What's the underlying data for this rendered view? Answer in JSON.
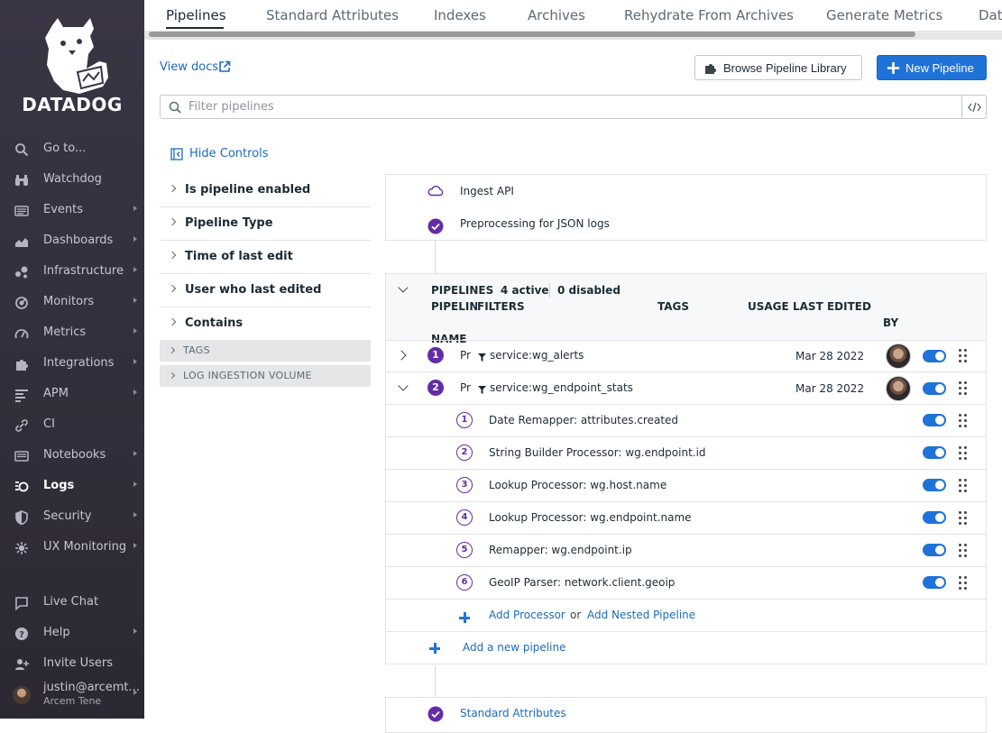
{
  "sidebar": {
    "brand": "DATADOG",
    "items": [
      {
        "label": "Go to...",
        "icon": "search-icon",
        "arrow": false
      },
      {
        "label": "Watchdog",
        "icon": "binoculars-icon",
        "arrow": false
      },
      {
        "label": "Events",
        "icon": "events-icon",
        "arrow": true
      },
      {
        "label": "Dashboards",
        "icon": "dashboards-icon",
        "arrow": true
      },
      {
        "label": "Infrastructure",
        "icon": "infrastructure-icon",
        "arrow": true
      },
      {
        "label": "Monitors",
        "icon": "monitors-icon",
        "arrow": true
      },
      {
        "label": "Metrics",
        "icon": "metrics-icon",
        "arrow": true
      },
      {
        "label": "Integrations",
        "icon": "puzzle-icon",
        "arrow": true
      },
      {
        "label": "APM",
        "icon": "apm-icon",
        "arrow": true
      },
      {
        "label": "CI",
        "icon": "ci-icon",
        "arrow": false
      },
      {
        "label": "Notebooks",
        "icon": "notebook-icon",
        "arrow": true
      },
      {
        "label": "Logs",
        "icon": "logs-icon",
        "arrow": true,
        "active": true
      },
      {
        "label": "Security",
        "icon": "shield-icon",
        "arrow": true
      },
      {
        "label": "UX Monitoring",
        "icon": "ux-icon",
        "arrow": true
      }
    ],
    "bottom": [
      {
        "label": "Live Chat",
        "icon": "chat-icon",
        "arrow": false
      },
      {
        "label": "Help",
        "icon": "help-icon",
        "arrow": true
      },
      {
        "label": "Invite Users",
        "icon": "invite-icon",
        "arrow": false
      }
    ],
    "user": {
      "name": "justin@arcemt...",
      "org": "Arcem Tene"
    }
  },
  "tabs": [
    "Pipelines",
    "Standard Attributes",
    "Indexes",
    "Archives",
    "Rehydrate From Archives",
    "Generate Metrics",
    "Dat"
  ],
  "toolbar": {
    "view_docs": "View docs",
    "browse_label": "Browse Pipeline Library",
    "new_label": "New Pipeline",
    "filter_placeholder": "Filter pipelines"
  },
  "controls": {
    "hide_label": "Hide Controls",
    "facets": [
      "Is pipeline enabled",
      "Pipeline Type",
      "Time of last edit",
      "User who last edited",
      "Contains"
    ],
    "groups": [
      "TAGS",
      "LOG INGESTION VOLUME"
    ]
  },
  "preprocessing": {
    "source": "Ingest API",
    "step": "Preprocessing for JSON logs"
  },
  "pipelines": {
    "header": {
      "title": "PIPELINES",
      "active": "4 active",
      "disabled": "0 disabled"
    },
    "columns": {
      "name_a": "PIPELINE",
      "name_b": "NAME",
      "filters": "FILTERS",
      "tags": "TAGS",
      "usage": "USAGE",
      "last_edited": "LAST EDITED",
      "by": "BY"
    },
    "rows": [
      {
        "num": "1",
        "name": "Pr",
        "filter": "service:wg_alerts",
        "date": "Mar 28 2022"
      },
      {
        "num": "2",
        "name": "Pr",
        "filter": "service:wg_endpoint_stats",
        "date": "Mar 28 2022"
      }
    ],
    "processors": [
      {
        "num": "1",
        "label": "Date Remapper: attributes.created"
      },
      {
        "num": "2",
        "label": "String Builder Processor: wg.endpoint.id"
      },
      {
        "num": "3",
        "label": "Lookup Processor: wg.host.name"
      },
      {
        "num": "4",
        "label": "Lookup Processor: wg.endpoint.name"
      },
      {
        "num": "5",
        "label": "Remapper: wg.endpoint.ip"
      },
      {
        "num": "6",
        "label": "GeoIP Parser: network.client.geoip"
      }
    ],
    "add_processor": "Add Processor",
    "or": "or",
    "add_nested": "Add Nested Pipeline",
    "add_pipeline": "Add a new pipeline"
  },
  "standard_attributes": "Standard Attributes",
  "colors": {
    "accent": "#632ca6",
    "link": "#1c6bc0",
    "primary_button": "#1f73d8",
    "sidebar": "#3a3544"
  }
}
